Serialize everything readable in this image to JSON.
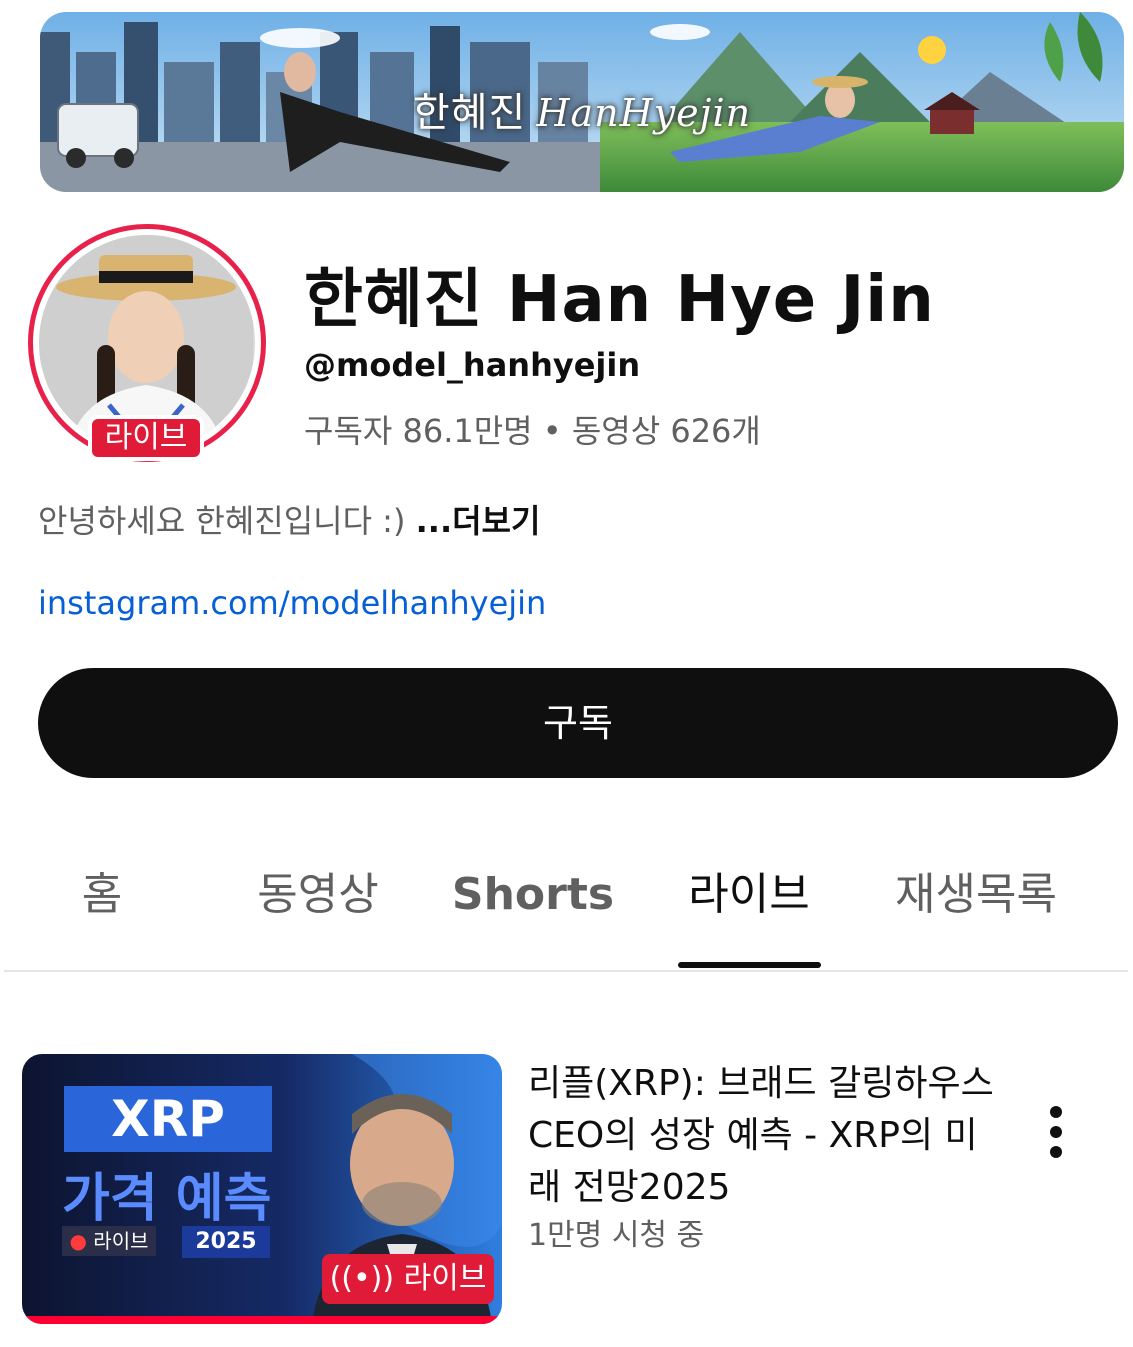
{
  "banner": {
    "title_korean": "한혜진",
    "title_script": "HanHyejin"
  },
  "channel": {
    "name": "한혜진 Han Hye Jin",
    "handle": "@model_hanhyejin",
    "stats": "구독자 86.1만명 • 동영상 626개",
    "avatar_live_badge": "라이브",
    "description": "안녕하세요 한혜진입니다 :)",
    "more_label": "...더보기",
    "link": "instagram.com/modelhanhyejin"
  },
  "subscribe_label": "구독",
  "tabs": [
    {
      "label": "홈",
      "active": false
    },
    {
      "label": "동영상",
      "active": false
    },
    {
      "label": "Shorts",
      "active": false
    },
    {
      "label": "라이브",
      "active": true
    },
    {
      "label": "재생목록",
      "active": false
    }
  ],
  "video": {
    "title": "리플(XRP): 브래드 갈링하우스 CEO의 성장 예측 - XRP의 미래 전망2025",
    "meta": "1만명 시청 중",
    "thumbnail": {
      "headline": "XRP",
      "subheadline": "가격 예측",
      "small_badge": "라이브",
      "year": "2025",
      "live_badge": "라이브",
      "live_icon": "broadcast-icon"
    },
    "progress": 1.0
  },
  "colors": {
    "live_red": "#e01b37",
    "link_blue": "#065fd4",
    "primary_text": "#0f0f0f",
    "secondary_text": "#606060"
  }
}
